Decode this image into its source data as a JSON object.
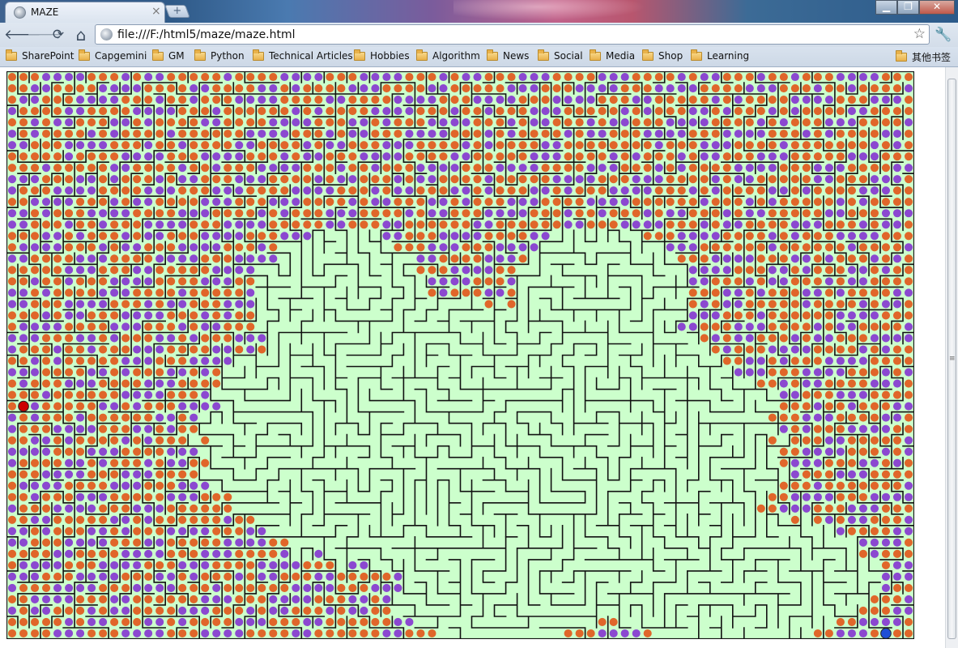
{
  "window": {
    "tab_title": "MAZE",
    "tab_close": "×",
    "new_tab": "+",
    "controls": {
      "minimize": "▁",
      "maximize": "❐",
      "close": "✕"
    }
  },
  "toolbar": {
    "back": "🡐",
    "forward": "🡒",
    "reload": "⟳",
    "home": "⌂",
    "url": "file:///F:/html5/maze/maze.html",
    "bookmark_star": "☆",
    "wrench": "🔧"
  },
  "bookmarks": {
    "items": [
      "SharePoint",
      "Capgemini",
      "GM",
      "Python",
      "Technical Articles",
      "Hobbies",
      "Algorithm",
      "News",
      "Social",
      "Media",
      "Shop",
      "Learning"
    ],
    "other": "其他书签"
  },
  "maze": {
    "cols": 80,
    "rows": 50,
    "start": {
      "col": 1,
      "row": 29
    },
    "end": {
      "col": 77,
      "row": 49
    },
    "colors": {
      "background": "#ccffcc",
      "wall": "#111111",
      "visited_dot": "#8b48d0",
      "frontier_dot": "#e0662a",
      "start_dot": "#cc0000",
      "end_dot": "#1f4fd6"
    }
  }
}
